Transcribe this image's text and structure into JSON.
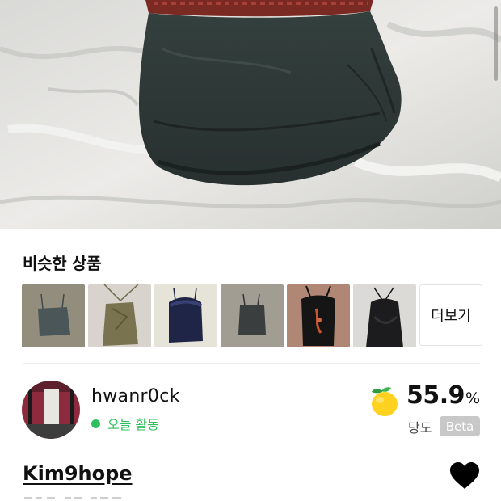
{
  "product_image": {
    "description_icon": "product-photo"
  },
  "similar": {
    "title": "비슷한 상품",
    "thumbnails": [
      {
        "icon": "camisole-grey-thumbnail"
      },
      {
        "icon": "halter-olive-thumbnail"
      },
      {
        "icon": "lace-navy-thumbnail"
      },
      {
        "icon": "camisole-charcoal-thumbnail"
      },
      {
        "icon": "beaded-black-thumbnail"
      },
      {
        "icon": "halter-black-thumbnail"
      }
    ],
    "more_label": "더보기"
  },
  "seller": {
    "name": "hwanr0ck",
    "activity": "오늘 활동",
    "activity_color": "#2fbf5e",
    "rating_value": "55.9",
    "rating_unit": "%",
    "rating_label": "당도",
    "beta_label": "Beta",
    "rating_icon": "lemon-icon"
  },
  "listing": {
    "username": "Kim9hope",
    "favorite_icon": "heart-icon"
  },
  "colors": {
    "accent_green": "#2fbf5e",
    "beta_bg": "#c8c8c8"
  }
}
